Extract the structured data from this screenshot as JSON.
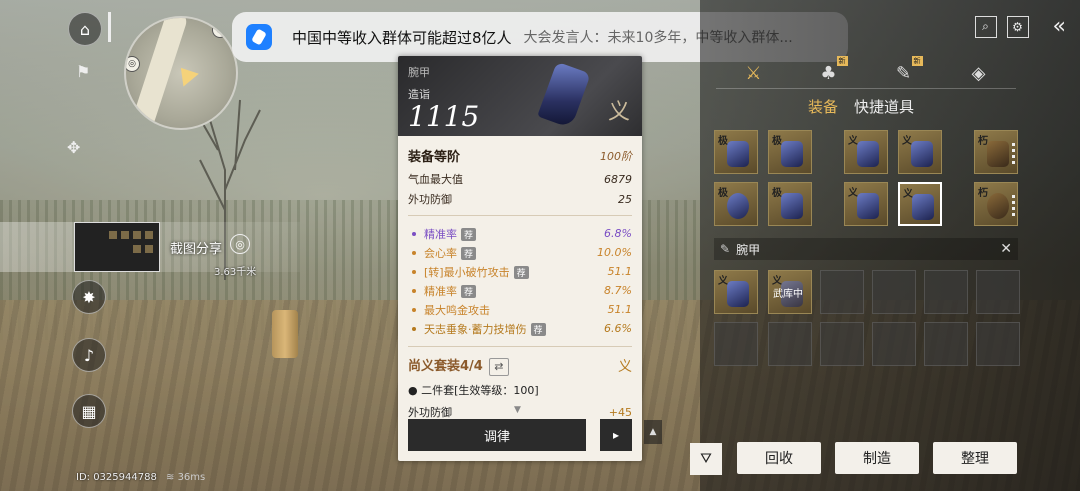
{
  "notification": {
    "title": "中国中等收入群体可能超过8亿人",
    "body": "大会发言人：未来10多年，中等收入群体..."
  },
  "hud": {
    "share_label": "截图分享",
    "share_distance": "3.63千米",
    "id_text": "ID: 0325944788",
    "ping_text": "36ms"
  },
  "tooltip": {
    "slot_name": "腕甲",
    "zaoyi_label": "造诣",
    "score": "1115",
    "set_mark": "义",
    "equip_tier_label": "装备等阶",
    "equip_tier_value": "100阶",
    "base_stats": [
      {
        "name": "气血最大值",
        "value": "6879"
      },
      {
        "name": "外功防御",
        "value": "25"
      }
    ],
    "attrs": [
      {
        "name": "精准率",
        "badge": "荐",
        "value": "6.8%",
        "color": "purple"
      },
      {
        "name": "会心率",
        "badge": "荐",
        "value": "10.0%",
        "color": "orange"
      },
      {
        "name": "[转]最小破竹攻击",
        "badge": "荐",
        "value": "51.1",
        "color": "orange"
      },
      {
        "name": "精准率",
        "badge": "荐",
        "value": "8.7%",
        "color": "orange"
      },
      {
        "name": "最大鸣金攻击",
        "badge": "",
        "value": "51.1",
        "color": "orange"
      },
      {
        "name": "天志垂象·蓄力技增伤",
        "badge": "荐",
        "value": "6.6%",
        "color": "gold"
      }
    ],
    "set_title": "尚义套装4/4",
    "set_swap_icon": "⇄",
    "set_line1": "二件套[生效等级：100]",
    "set_line2_name": "外功防御",
    "set_line2_value": "+45",
    "tune_button": "调律",
    "next_button": "▸"
  },
  "right_panel": {
    "subtabs": [
      "装备",
      "快捷道具"
    ],
    "filter_label": "腕甲",
    "in_use_label": "武库中",
    "new_badge": "新",
    "buttons": {
      "recycle": "回收",
      "craft": "制造",
      "sort": "整理"
    }
  }
}
